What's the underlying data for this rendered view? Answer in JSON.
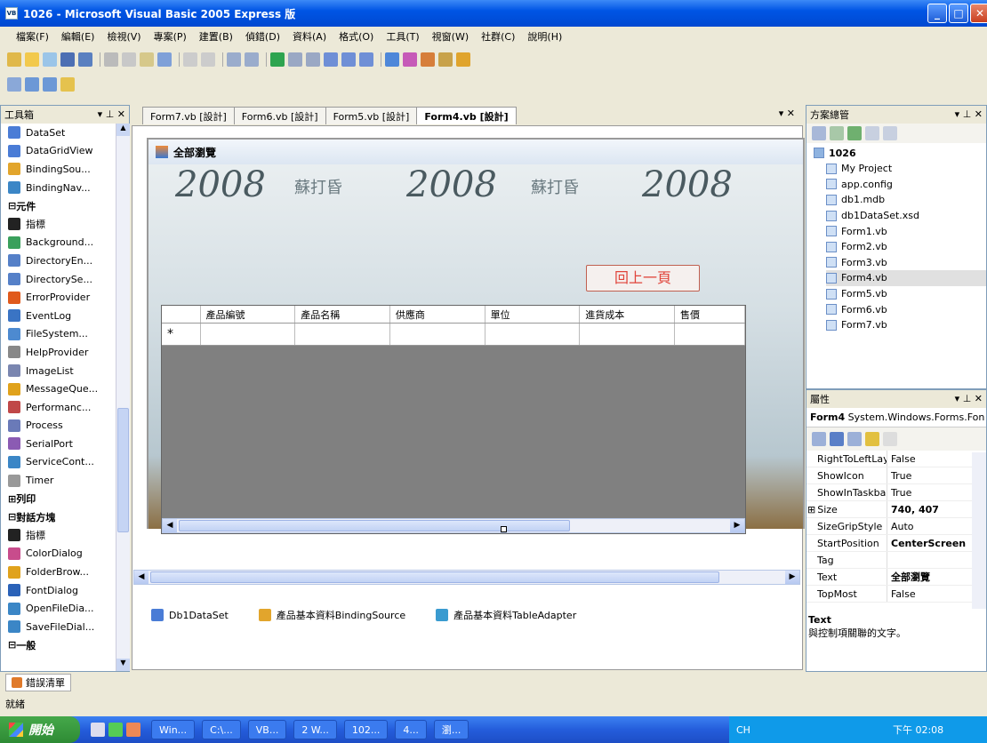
{
  "window": {
    "title": "1026 - Microsoft Visual Basic 2005 Express 版"
  },
  "menu": [
    "檔案(F)",
    "編輯(E)",
    "檢視(V)",
    "專案(P)",
    "建置(B)",
    "偵錯(D)",
    "資料(A)",
    "格式(O)",
    "工具(T)",
    "視窗(W)",
    "社群(C)",
    "說明(H)"
  ],
  "toolbox": {
    "title": "工具箱",
    "pins": "▾ ⊥ ✕",
    "items": [
      {
        "label": "DataSet",
        "color": "#4a7cd6"
      },
      {
        "label": "DataGridView",
        "color": "#4a7cd6"
      },
      {
        "label": "BindingSou...",
        "color": "#e2a52c"
      },
      {
        "label": "BindingNav...",
        "color": "#3b86c6"
      },
      {
        "label": "元件",
        "cat": true
      },
      {
        "label": "指標",
        "color": "#222"
      },
      {
        "label": "Background...",
        "color": "#3aa05c"
      },
      {
        "label": "DirectoryEn...",
        "color": "#5580c8"
      },
      {
        "label": "DirectorySe...",
        "color": "#5580c8"
      },
      {
        "label": "ErrorProvider",
        "color": "#e05a1c"
      },
      {
        "label": "EventLog",
        "color": "#3a74c4"
      },
      {
        "label": "FileSystem...",
        "color": "#4d8ad0"
      },
      {
        "label": "HelpProvider",
        "color": "#888"
      },
      {
        "label": "ImageList",
        "color": "#7a86b0"
      },
      {
        "label": "MessageQue...",
        "color": "#e0a21c"
      },
      {
        "label": "Performanc...",
        "color": "#c04848"
      },
      {
        "label": "Process",
        "color": "#6a7ab8"
      },
      {
        "label": "SerialPort",
        "color": "#8b5bb3"
      },
      {
        "label": "ServiceCont...",
        "color": "#3b86c6"
      },
      {
        "label": "Timer",
        "color": "#999"
      },
      {
        "label": "列印",
        "cat": true
      },
      {
        "label": "對話方塊",
        "cat": true
      },
      {
        "label": "指標",
        "color": "#222"
      },
      {
        "label": "ColorDialog",
        "color": "#c84c8c"
      },
      {
        "label": "FolderBrow...",
        "color": "#e0a21c"
      },
      {
        "label": "FontDialog",
        "color": "#2a62b8"
      },
      {
        "label": "OpenFileDia...",
        "color": "#3b86c6"
      },
      {
        "label": "SaveFileDial...",
        "color": "#3b86c6"
      },
      {
        "label": "一般",
        "cat": true
      }
    ]
  },
  "errorlist": "錯誤清單",
  "status": "就緒",
  "tabs": [
    {
      "label": "Form7.vb [設計]"
    },
    {
      "label": "Form6.vb [設計]"
    },
    {
      "label": "Form5.vb [設計]"
    },
    {
      "label": "Form4.vb [設計]",
      "active": true
    }
  ],
  "form": {
    "title": "全部瀏覽",
    "back_button": "回上一頁",
    "deco_year": "2008",
    "deco_sig": "蘇打昏",
    "columns": [
      "產品編號",
      "產品名稱",
      "供應商",
      "單位",
      "進貨成本",
      "售價"
    ],
    "new_row_marker": "*"
  },
  "tray": [
    "Db1DataSet",
    "產品基本資料BindingSource",
    "產品基本資料TableAdapter"
  ],
  "solution": {
    "title": "方案總管",
    "project": "1026",
    "items": [
      "My Project",
      "app.config",
      "db1.mdb",
      "db1DataSet.xsd",
      "Form1.vb",
      "Form2.vb",
      "Form3.vb",
      "Form4.vb",
      "Form5.vb",
      "Form6.vb",
      "Form7.vb"
    ],
    "selected": "Form4.vb"
  },
  "properties": {
    "title": "屬性",
    "object": "Form4",
    "object_type": "System.Windows.Forms.Fon",
    "rows": [
      {
        "k": "RightToLeftLay",
        "v": "False"
      },
      {
        "k": "ShowIcon",
        "v": "True"
      },
      {
        "k": "ShowInTaskbar",
        "v": "True"
      },
      {
        "k": "Size",
        "v": "740, 407",
        "bold": true,
        "expand": "⊞"
      },
      {
        "k": "SizeGripStyle",
        "v": "Auto"
      },
      {
        "k": "StartPosition",
        "v": "CenterScreen",
        "bold": true
      },
      {
        "k": "Tag",
        "v": ""
      },
      {
        "k": "Text",
        "v": "全部瀏覽",
        "bold": true
      },
      {
        "k": "TopMost",
        "v": "False"
      }
    ],
    "desc_title": "Text",
    "desc": "與控制項關聯的文字。"
  },
  "taskbar": {
    "start": "開始",
    "tasks": [
      "Win...",
      "C:\\...",
      "VB...",
      "2 W...",
      "102...",
      "4...",
      "瀏..."
    ],
    "ime": "CH",
    "clock": "下午 02:08"
  }
}
